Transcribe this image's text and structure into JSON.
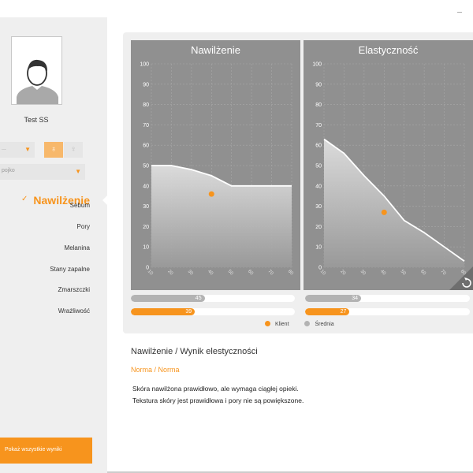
{
  "user": {
    "name": "Test SS"
  },
  "sidebar": {
    "select_a": "...",
    "select_b": "pojko",
    "active_item": "Nawilżenie",
    "items": [
      "Sebum",
      "Pory",
      "Melanina",
      "Stany zapalne",
      "Zmarszczki",
      "Wrażliwość"
    ],
    "show_all_label": "Pokaż wszystkie wyniki"
  },
  "charts": [
    {
      "title": "Nawilżenie",
      "y_ticks": [
        "100",
        "90",
        "80",
        "70",
        "60",
        "50",
        "40",
        "30",
        "20",
        "10",
        "0"
      ],
      "x_ticks": [
        "10",
        "20",
        "30",
        "40",
        "50",
        "60",
        "70",
        "80"
      ],
      "client_point": [
        40,
        36
      ],
      "curve": [
        [
          10,
          50
        ],
        [
          20,
          50
        ],
        [
          30,
          48
        ],
        [
          40,
          45
        ],
        [
          50,
          40
        ],
        [
          60,
          40
        ],
        [
          70,
          40
        ],
        [
          80,
          40
        ]
      ]
    },
    {
      "title": "Elastyczność",
      "y_ticks": [
        "100",
        "90",
        "80",
        "70",
        "60",
        "50",
        "40",
        "30",
        "20",
        "10",
        "0"
      ],
      "x_ticks": [
        "10",
        "20",
        "30",
        "40",
        "50",
        "60",
        "70",
        "80"
      ],
      "client_point": [
        40,
        27
      ],
      "curve": [
        [
          10,
          63
        ],
        [
          20,
          56
        ],
        [
          30,
          45
        ],
        [
          40,
          35
        ],
        [
          50,
          23
        ],
        [
          60,
          17
        ],
        [
          70,
          10
        ],
        [
          80,
          3
        ]
      ]
    }
  ],
  "bars": {
    "moisture": {
      "average": 45,
      "client": 39
    },
    "elasticity": {
      "average": 34,
      "client": 27
    }
  },
  "legend": {
    "client": "Klient",
    "average": "Średnia"
  },
  "result": {
    "title": "Nawilżenie / Wynik elestyczności",
    "norm": "Norma / Norma",
    "line1": "Skóra nawilżona prawidłowo, ale wymaga ciągłej opieki.",
    "line2": "Tekstura skóry jest prawidłowa i pory nie są powiększone."
  },
  "colors": {
    "accent": "#f7941d",
    "chart_bg": "#909090",
    "average": "#b3b3b3"
  },
  "icons": {
    "female": "female-icon",
    "male": "male-icon",
    "reload": "reload-icon"
  }
}
